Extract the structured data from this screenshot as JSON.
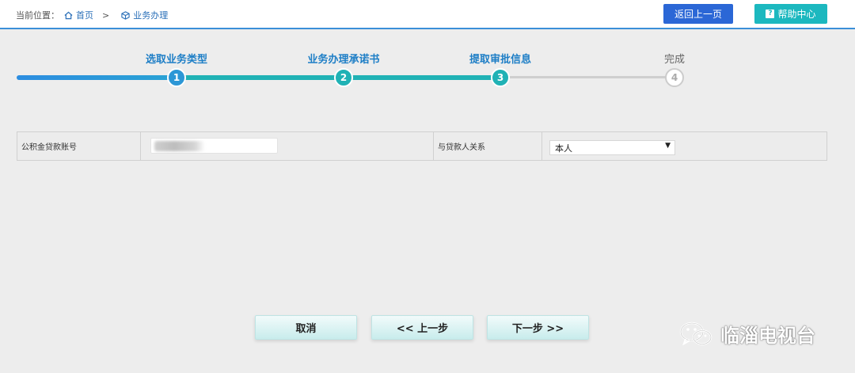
{
  "breadcrumb": {
    "label": "当前位置：",
    "home": "首页",
    "separator": ">",
    "current": "业务办理"
  },
  "header": {
    "back_button": "返回上一页",
    "help_button": "帮助中心",
    "help_icon_glyph": "?"
  },
  "steps": [
    {
      "label": "选取业务类型",
      "number": "1",
      "status": "done"
    },
    {
      "label": "业务办理承诺书",
      "number": "2",
      "status": "done"
    },
    {
      "label": "提取审批信息",
      "number": "3",
      "status": "current"
    },
    {
      "label": "完成",
      "number": "4",
      "status": "todo"
    }
  ],
  "form": {
    "account_label": "公积金贷款账号",
    "account_value": "",
    "relation_label": "与贷款人关系",
    "relation_value": "本人"
  },
  "actions": {
    "cancel": "取消",
    "prev": "<< 上一步",
    "next": "下一步 >>"
  },
  "watermark": {
    "text": "临淄电视台",
    "icon": "wechat-icon"
  },
  "colors": {
    "accent_blue": "#2b67d6",
    "accent_teal": "#1cb8bf",
    "progress_teal": "#20b2b5",
    "link_blue": "#1d7ec6"
  }
}
